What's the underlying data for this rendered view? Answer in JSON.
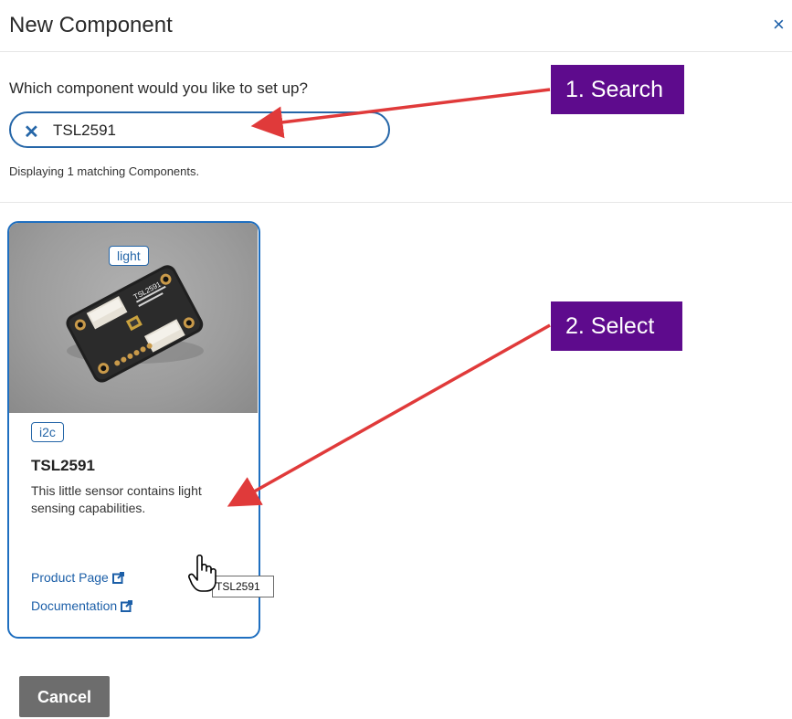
{
  "dialog": {
    "title": "New Component",
    "close_glyph": "×"
  },
  "search": {
    "question": "Which component would you like to set up?",
    "value": "TSL2591",
    "clear_glyph": "✕",
    "match_count": "Displaying 1 matching Components."
  },
  "card": {
    "category_tag": "light",
    "bus_tag": "i2c",
    "name": "TSL2591",
    "description": "This little sensor contains light sensing capabilities.",
    "product_link": "Product Page",
    "doc_link": "Documentation",
    "tooltip": "TSL2591",
    "board_silkscreen": "TSL2591"
  },
  "annotations": {
    "step1": "1. Search",
    "step2": "2. Select"
  },
  "footer": {
    "cancel_label": "Cancel"
  },
  "colors": {
    "accent": "#2566a8",
    "callout": "#5e0b8d",
    "arrow": "#e03a3a",
    "cancel": "#6d6d6d"
  }
}
